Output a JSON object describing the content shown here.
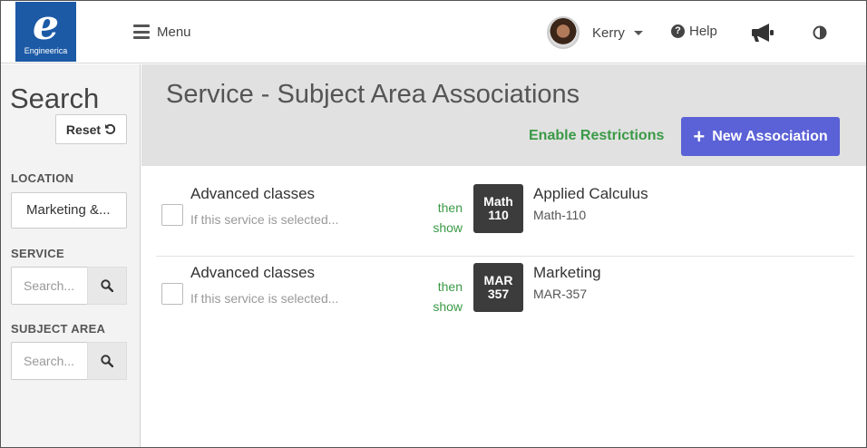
{
  "header": {
    "logo_mark": "e",
    "logo_brand": "Engineerica",
    "menu_label": "Menu",
    "user_name": "Kerry",
    "help_label": "Help"
  },
  "sidebar": {
    "title": "Search",
    "reset_label": "Reset",
    "location_label": "LOCATION",
    "location_value": "Marketing &...",
    "service_label": "SERVICE",
    "service_placeholder": "Search...",
    "subject_area_label": "SUBJECT AREA",
    "subject_area_placeholder": "Search..."
  },
  "main": {
    "title": "Service - Subject Area Associations",
    "enable_restrictions_label": "Enable Restrictions",
    "new_association_label": "New Association",
    "associations": [
      {
        "service_name": "Advanced classes",
        "service_subtext": "If this service is selected...",
        "then_label": "then",
        "show_label": "show",
        "badge_line1": "Math",
        "badge_line2": "110",
        "area_name": "Applied Calculus",
        "area_code": "Math-110"
      },
      {
        "service_name": "Advanced classes",
        "service_subtext": "If this service is selected...",
        "then_label": "then",
        "show_label": "show",
        "badge_line1": "MAR",
        "badge_line2": "357",
        "area_name": "Marketing",
        "area_code": "MAR-357"
      }
    ]
  },
  "colors": {
    "brand_blue": "#1c5aa6",
    "primary_button": "#5b61d6",
    "success_green": "#3a9a46",
    "badge_dark": "#3c3c3c"
  },
  "icons": [
    "hamburger-icon",
    "avatar",
    "caret-down-icon",
    "question-circle-icon",
    "megaphone-icon",
    "contrast-icon",
    "undo-icon",
    "search-icon",
    "plus-icon"
  ]
}
